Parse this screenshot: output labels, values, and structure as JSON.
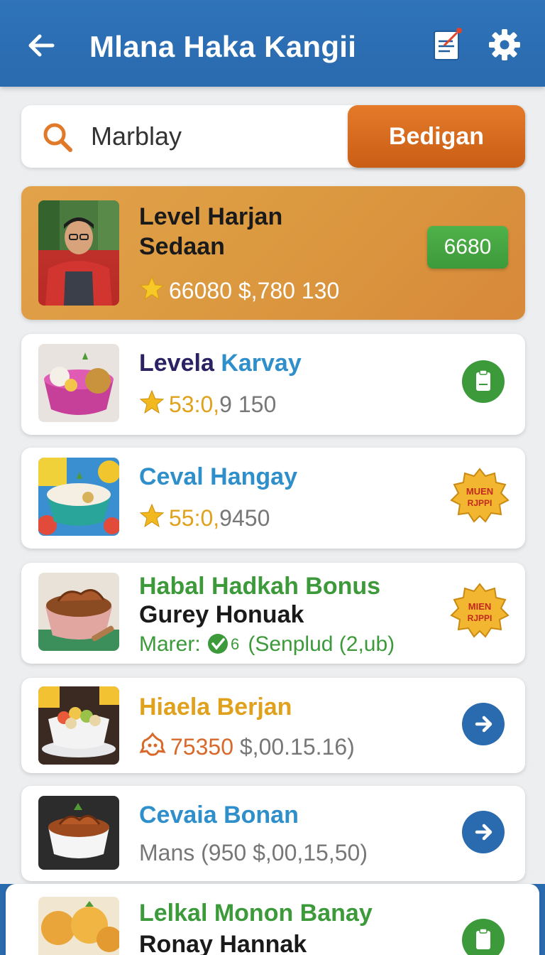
{
  "header": {
    "title": "Mlana Haka Kangii",
    "back_icon": "arrow-left-icon",
    "doc_icon": "document-edit-icon",
    "settings_icon": "gear-icon"
  },
  "search": {
    "value": "Marblay",
    "button_label": "Bedigan"
  },
  "featured": {
    "title_line1": "Level Harjan",
    "title_line2": "Sedaan",
    "meta": "66080 $,780 130",
    "tag": "6680"
  },
  "items": [
    {
      "title_a": "Levela",
      "title_b": "Karvay",
      "meta_a": "53:0,",
      "meta_b": "9 150",
      "action_icon": "clipboard-icon"
    },
    {
      "title": "Ceval Hangay",
      "meta_a": "55:0,",
      "meta_b": "9450",
      "badge_text_1": "MUEN",
      "badge_text_2": "RJPPI"
    },
    {
      "title": "Habal Hadkah Bonus",
      "subtitle": "Gurey Honuak",
      "meta": "Marer:",
      "meta_b": "(Senplud (2,ub)",
      "badge_text_1": "MIEN",
      "badge_text_2": "RJPPI"
    },
    {
      "title": "Hiaela Berjan",
      "meta_a": "75350",
      "meta_b": "$,00.15.16)",
      "action_icon": "arrow-right-icon"
    },
    {
      "title": "Cevaia Bonan",
      "meta": "Mans (950 $,00,15,50)",
      "action_icon": "arrow-right-icon"
    },
    {
      "title": "Lelkal Monon Banay",
      "subtitle": "Ronay Hannak",
      "action_icon": "clipboard-icon"
    }
  ],
  "colors": {
    "header": "#2f73b9",
    "accent_orange": "#d86a1f",
    "green": "#3c9a3a",
    "blue_text": "#2f8fcb",
    "gold": "#e6a018"
  }
}
